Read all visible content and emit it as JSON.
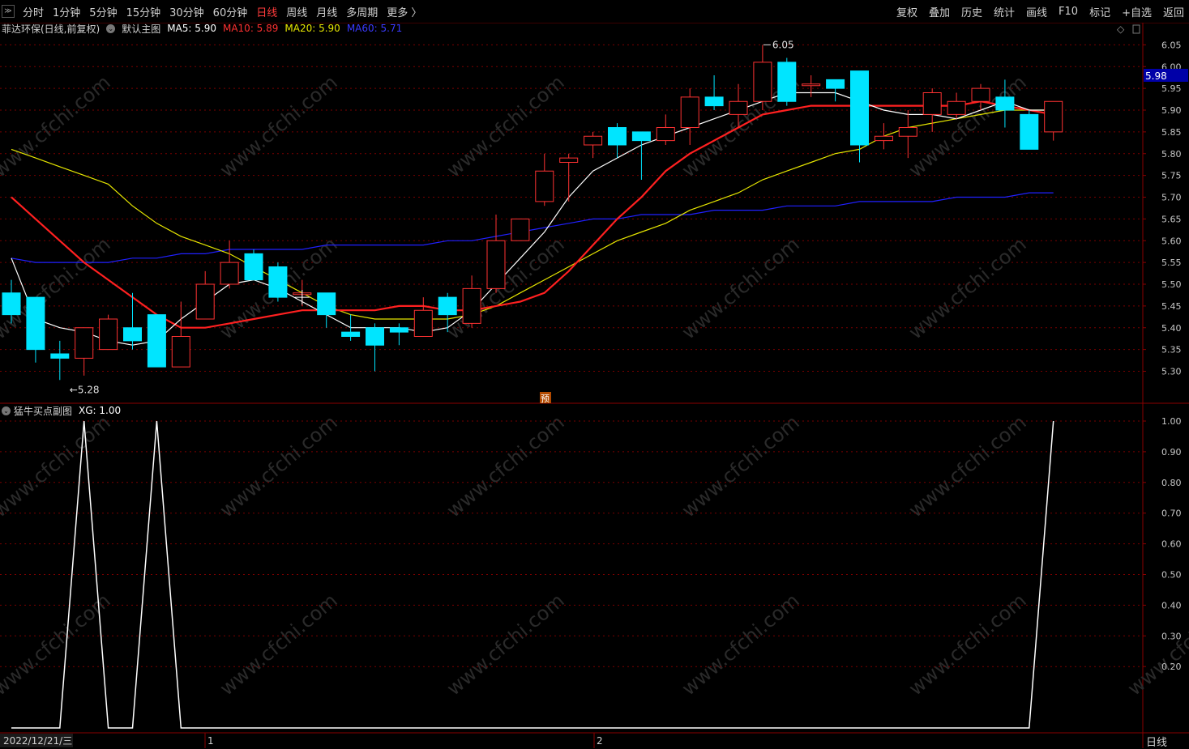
{
  "toolbar": {
    "periods": [
      "分时",
      "1分钟",
      "5分钟",
      "15分钟",
      "30分钟",
      "60分钟",
      "日线",
      "周线",
      "月线",
      "多周期",
      "更多 〉"
    ],
    "active_period": "日线",
    "tools": [
      "复权",
      "叠加",
      "历史",
      "统计",
      "画线",
      "F10",
      "标记",
      "+自选",
      "返回"
    ]
  },
  "main_legend": {
    "stock": "菲达环保(日线,前复权)",
    "template": "默认主图",
    "ma5": "MA5: 5.90",
    "ma10": "MA10: 5.89",
    "ma20": "MA20: 5.90",
    "ma60": "MA60: 5.71"
  },
  "sub_legend": {
    "name": "猛牛买点副图",
    "xg": "XG: 1.00"
  },
  "colors": {
    "up": "#ff3232",
    "down": "#00e5ff",
    "ma5": "#ffffff",
    "ma10": "#ff2020",
    "ma20": "#e6e600",
    "ma60": "#2020ff",
    "grid": "#7a0000",
    "axis_text": "#c8c8c8",
    "current_price_bg": "#0000a8"
  },
  "current_price_label": "5.98",
  "high_marker": "6.05",
  "low_marker": "5.28",
  "forecast_badge": "预",
  "watermark": "www.cfchi.com",
  "x_labels": {
    "start_date": "2022/12/21/三",
    "month1": "1",
    "month2": "2"
  },
  "bottom_right": "日线",
  "chart_data": [
    {
      "type": "candlestick",
      "title": "菲达环保(日线,前复权)",
      "y_axis_ticks": [
        "6.05",
        "6.00",
        "5.95",
        "5.90",
        "5.85",
        "5.80",
        "5.75",
        "5.70",
        "5.65",
        "5.60",
        "5.55",
        "5.50",
        "5.45",
        "5.40",
        "5.35",
        "5.30"
      ],
      "ylim": [
        5.26,
        6.06
      ],
      "candles": [
        {
          "o": 5.48,
          "c": 5.43,
          "h": 5.51,
          "l": 5.41
        },
        {
          "o": 5.47,
          "c": 5.35,
          "h": 5.47,
          "l": 5.32
        },
        {
          "o": 5.34,
          "c": 5.33,
          "h": 5.37,
          "l": 5.28
        },
        {
          "o": 5.33,
          "c": 5.4,
          "h": 5.4,
          "l": 5.29
        },
        {
          "o": 5.35,
          "c": 5.42,
          "h": 5.43,
          "l": 5.35
        },
        {
          "o": 5.4,
          "c": 5.37,
          "h": 5.48,
          "l": 5.35
        },
        {
          "o": 5.43,
          "c": 5.31,
          "h": 5.43,
          "l": 5.31
        },
        {
          "o": 5.31,
          "c": 5.38,
          "h": 5.46,
          "l": 5.31
        },
        {
          "o": 5.42,
          "c": 5.5,
          "h": 5.53,
          "l": 5.42
        },
        {
          "o": 5.5,
          "c": 5.55,
          "h": 5.6,
          "l": 5.49
        },
        {
          "o": 5.57,
          "c": 5.51,
          "h": 5.58,
          "l": 5.51
        },
        {
          "o": 5.54,
          "c": 5.47,
          "h": 5.55,
          "l": 5.46
        },
        {
          "o": 5.48,
          "c": 5.48,
          "h": 5.51,
          "l": 5.45
        },
        {
          "o": 5.48,
          "c": 5.43,
          "h": 5.48,
          "l": 5.4
        },
        {
          "o": 5.39,
          "c": 5.38,
          "h": 5.43,
          "l": 5.37
        },
        {
          "o": 5.4,
          "c": 5.36,
          "h": 5.41,
          "l": 5.3
        },
        {
          "o": 5.4,
          "c": 5.39,
          "h": 5.41,
          "l": 5.36
        },
        {
          "o": 5.38,
          "c": 5.44,
          "h": 5.47,
          "l": 5.38
        },
        {
          "o": 5.47,
          "c": 5.43,
          "h": 5.48,
          "l": 5.39
        },
        {
          "o": 5.41,
          "c": 5.49,
          "h": 5.52,
          "l": 5.4
        },
        {
          "o": 5.49,
          "c": 5.6,
          "h": 5.66,
          "l": 5.48
        },
        {
          "o": 5.6,
          "c": 5.65,
          "h": 5.65,
          "l": 5.6
        },
        {
          "o": 5.69,
          "c": 5.76,
          "h": 5.8,
          "l": 5.68
        },
        {
          "o": 5.78,
          "c": 5.79,
          "h": 5.8,
          "l": 5.69
        },
        {
          "o": 5.82,
          "c": 5.84,
          "h": 5.85,
          "l": 5.79
        },
        {
          "o": 5.86,
          "c": 5.82,
          "h": 5.87,
          "l": 5.79
        },
        {
          "o": 5.85,
          "c": 5.83,
          "h": 5.85,
          "l": 5.74
        },
        {
          "o": 5.83,
          "c": 5.86,
          "h": 5.89,
          "l": 5.82
        },
        {
          "o": 5.86,
          "c": 5.93,
          "h": 5.95,
          "l": 5.82
        },
        {
          "o": 5.93,
          "c": 5.91,
          "h": 5.98,
          "l": 5.9
        },
        {
          "o": 5.89,
          "c": 5.92,
          "h": 5.96,
          "l": 5.86
        },
        {
          "o": 5.92,
          "c": 6.01,
          "h": 6.05,
          "l": 5.9
        },
        {
          "o": 6.01,
          "c": 5.92,
          "h": 6.02,
          "l": 5.91
        },
        {
          "o": 5.96,
          "c": 5.96,
          "h": 5.98,
          "l": 5.93
        },
        {
          "o": 5.97,
          "c": 5.95,
          "h": 5.97,
          "l": 5.92
        },
        {
          "o": 5.99,
          "c": 5.82,
          "h": 5.99,
          "l": 5.78
        },
        {
          "o": 5.83,
          "c": 5.84,
          "h": 5.87,
          "l": 5.81
        },
        {
          "o": 5.84,
          "c": 5.86,
          "h": 5.9,
          "l": 5.79
        },
        {
          "o": 5.89,
          "c": 5.94,
          "h": 5.95,
          "l": 5.85
        },
        {
          "o": 5.89,
          "c": 5.92,
          "h": 5.94,
          "l": 5.88
        },
        {
          "o": 5.92,
          "c": 5.95,
          "h": 5.96,
          "l": 5.9
        },
        {
          "o": 5.93,
          "c": 5.9,
          "h": 5.97,
          "l": 5.86
        },
        {
          "o": 5.89,
          "c": 5.81,
          "h": 5.9,
          "l": 5.81
        },
        {
          "o": 5.85,
          "c": 5.92,
          "h": 5.92,
          "l": 5.83
        }
      ],
      "ma5": [
        5.56,
        5.42,
        5.4,
        5.39,
        5.37,
        5.36,
        5.37,
        5.42,
        5.46,
        5.5,
        5.51,
        5.49,
        5.46,
        5.43,
        5.4,
        5.4,
        5.4,
        5.39,
        5.4,
        5.44,
        5.5,
        5.56,
        5.62,
        5.7,
        5.76,
        5.79,
        5.82,
        5.84,
        5.86,
        5.88,
        5.9,
        5.92,
        5.94,
        5.94,
        5.94,
        5.92,
        5.9,
        5.89,
        5.89,
        5.88,
        5.9,
        5.92,
        5.9,
        5.9
      ],
      "ma10": [
        5.7,
        5.65,
        5.6,
        5.55,
        5.51,
        5.47,
        5.43,
        5.4,
        5.4,
        5.41,
        5.42,
        5.43,
        5.44,
        5.44,
        5.44,
        5.44,
        5.45,
        5.45,
        5.44,
        5.44,
        5.45,
        5.46,
        5.48,
        5.53,
        5.59,
        5.65,
        5.7,
        5.76,
        5.8,
        5.83,
        5.86,
        5.89,
        5.9,
        5.91,
        5.91,
        5.91,
        5.91,
        5.91,
        5.91,
        5.91,
        5.92,
        5.91,
        5.9,
        5.89
      ],
      "ma20": [
        5.81,
        5.79,
        5.77,
        5.75,
        5.73,
        5.68,
        5.64,
        5.61,
        5.59,
        5.57,
        5.54,
        5.51,
        5.48,
        5.45,
        5.43,
        5.42,
        5.42,
        5.42,
        5.42,
        5.43,
        5.45,
        5.48,
        5.51,
        5.54,
        5.57,
        5.6,
        5.62,
        5.64,
        5.67,
        5.69,
        5.71,
        5.74,
        5.76,
        5.78,
        5.8,
        5.81,
        5.84,
        5.86,
        5.87,
        5.88,
        5.89,
        5.9,
        5.9,
        5.9
      ],
      "ma60": [
        5.56,
        5.55,
        5.55,
        5.55,
        5.55,
        5.56,
        5.56,
        5.57,
        5.57,
        5.58,
        5.58,
        5.58,
        5.58,
        5.59,
        5.59,
        5.59,
        5.59,
        5.59,
        5.6,
        5.6,
        5.61,
        5.62,
        5.63,
        5.64,
        5.65,
        5.65,
        5.66,
        5.66,
        5.66,
        5.67,
        5.67,
        5.67,
        5.68,
        5.68,
        5.68,
        5.69,
        5.69,
        5.69,
        5.69,
        5.7,
        5.7,
        5.7,
        5.71,
        5.71
      ]
    },
    {
      "type": "line",
      "title": "猛牛买点副图",
      "series": [
        {
          "name": "XG",
          "values": [
            0,
            0,
            0,
            1,
            0,
            0,
            1,
            0,
            0,
            0,
            0,
            0,
            0,
            0,
            0,
            0,
            0,
            0,
            0,
            0,
            0,
            0,
            0,
            0,
            0,
            0,
            0,
            0,
            0,
            0,
            0,
            0,
            0,
            0,
            0,
            0,
            0,
            0,
            0,
            0,
            0,
            0,
            0,
            1
          ]
        }
      ],
      "y_axis_ticks": [
        "1.00",
        "0.90",
        "0.80",
        "0.70",
        "0.60",
        "0.50",
        "0.40",
        "0.30",
        "0.20"
      ],
      "ylim": [
        0,
        1
      ]
    }
  ]
}
